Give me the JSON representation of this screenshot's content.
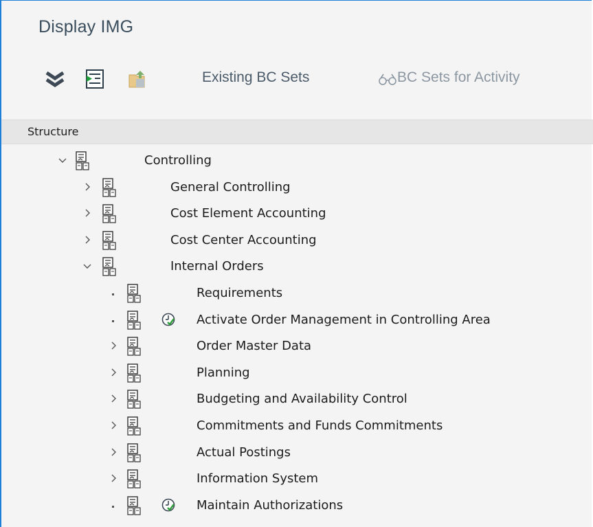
{
  "window": {
    "title": "Display IMG"
  },
  "toolbar": {
    "expand_icon": "double-chevron-down-icon",
    "execute_icon": "execute-icon",
    "transport_icon": "transport-icon",
    "existing_bc_sets_label": "Existing BC Sets",
    "bc_sets_for_activity_label": "BC Sets for Activity",
    "bc_sets_icon": "glasses-icon"
  },
  "structure": {
    "header": "Structure"
  },
  "tree": [
    {
      "label": "Controlling",
      "expander": "expanded",
      "level": 0,
      "status": false
    },
    {
      "label": "General Controlling",
      "expander": "collapsed",
      "level": 1,
      "status": false
    },
    {
      "label": "Cost Element Accounting",
      "expander": "collapsed",
      "level": 1,
      "status": false
    },
    {
      "label": "Cost Center Accounting",
      "expander": "collapsed",
      "level": 1,
      "status": false
    },
    {
      "label": "Internal Orders",
      "expander": "expanded",
      "level": 1,
      "status": false
    },
    {
      "label": "Requirements",
      "expander": "leaf",
      "level": 2,
      "status": false
    },
    {
      "label": "Activate Order Management in Controlling Area",
      "expander": "leaf",
      "level": 2,
      "status": true
    },
    {
      "label": "Order Master Data",
      "expander": "collapsed",
      "level": 2,
      "status": false
    },
    {
      "label": "Planning",
      "expander": "collapsed",
      "level": 2,
      "status": false
    },
    {
      "label": "Budgeting and Availability Control",
      "expander": "collapsed",
      "level": 2,
      "status": false
    },
    {
      "label": "Commitments and Funds Commitments",
      "expander": "collapsed",
      "level": 2,
      "status": false
    },
    {
      "label": "Actual Postings",
      "expander": "collapsed",
      "level": 2,
      "status": false
    },
    {
      "label": "Information System",
      "expander": "collapsed",
      "level": 2,
      "status": false
    },
    {
      "label": "Maintain Authorizations",
      "expander": "leaf",
      "level": 2,
      "status": true
    }
  ],
  "colors": {
    "window_border": "#1f7fd6",
    "status_green": "#2e9e3a",
    "title_text": "#3a4d5c"
  }
}
